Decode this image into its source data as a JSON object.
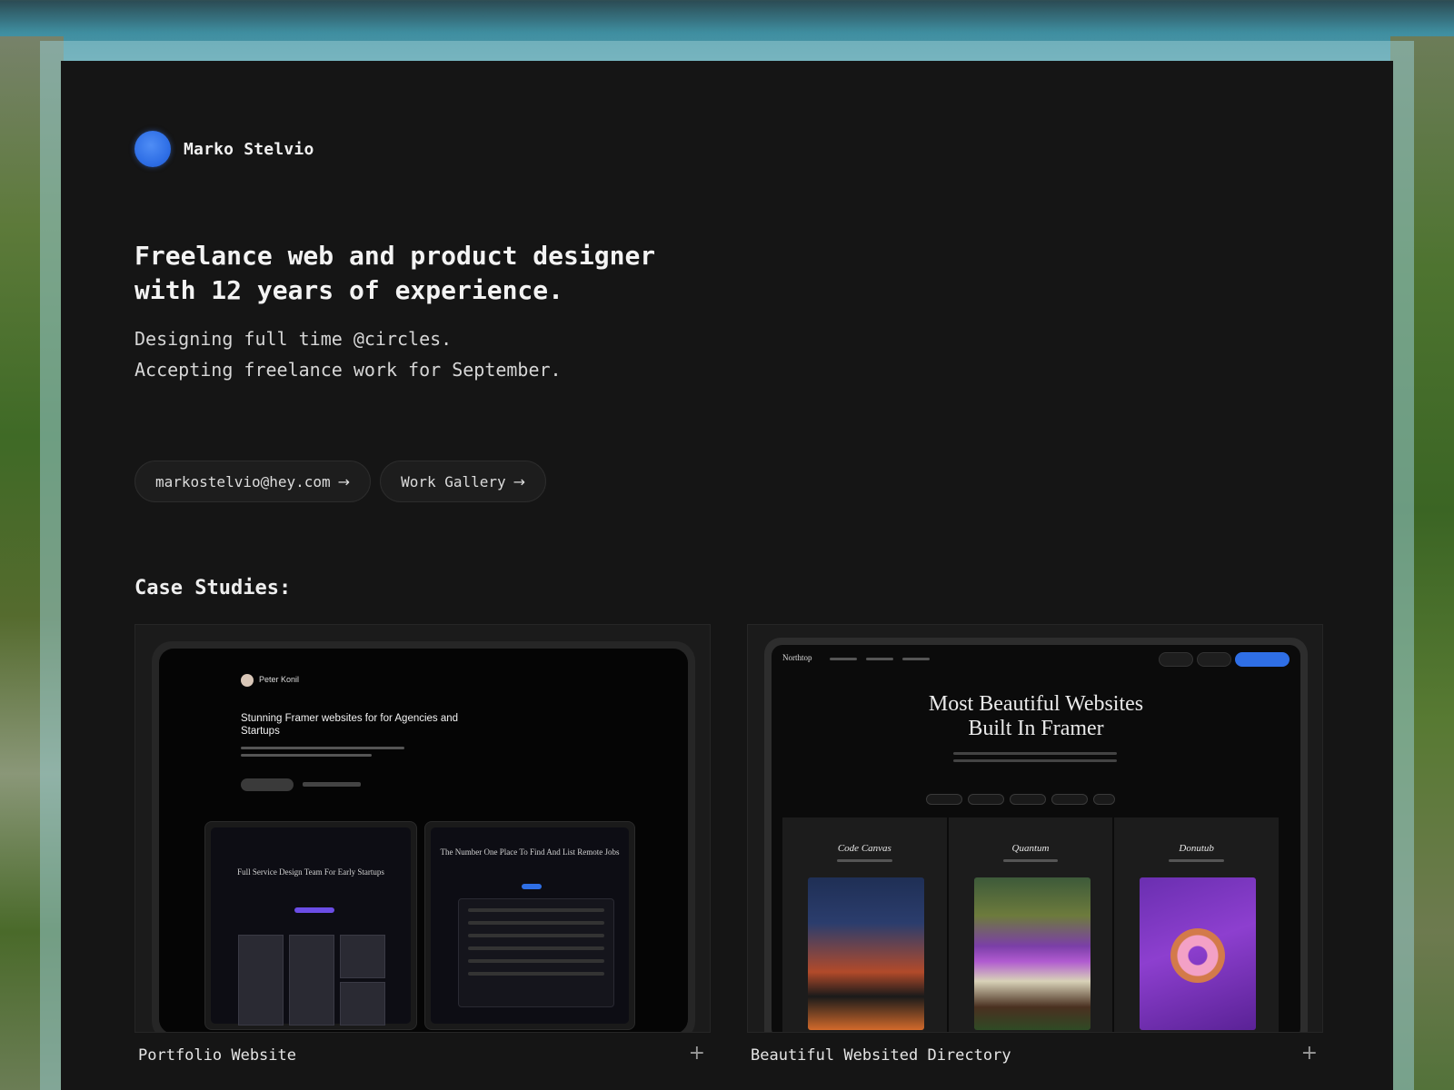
{
  "profile": {
    "name": "Marko Stelvio"
  },
  "hero": {
    "headline_line1": "Freelance web and product designer",
    "headline_line2": "with 12 years of experience.",
    "sub_line1": "Designing full time @circles.",
    "sub_line2": "Accepting freelance work for September."
  },
  "links": {
    "email": "markostelvio@hey.com",
    "gallery": "Work Gallery",
    "arrow": "→"
  },
  "case_studies": {
    "title": "Case Studies:",
    "items": [
      {
        "label": "Portfolio Website",
        "action_icon": "plus-icon",
        "preview": {
          "name": "Peter Konil",
          "headline": "Stunning Framer websites for for Agencies and Startups",
          "sub_a_title": "Full Service Design Team For Early Startups",
          "sub_b_title": "The Number One Place To Find And List Remote Jobs"
        }
      },
      {
        "label": "Beautiful Websited Directory",
        "action_icon": "plus-icon",
        "preview": {
          "logo": "Northtop",
          "headline_line1": "Most Beautiful Websites",
          "headline_line2": "Built In Framer",
          "tiles": [
            "Code Canvas",
            "Quantum",
            "Donutub"
          ]
        }
      }
    ]
  },
  "colors": {
    "accent_blue": "#2f6fe6",
    "page_bg": "#151515",
    "text": "#e9e9e9"
  }
}
